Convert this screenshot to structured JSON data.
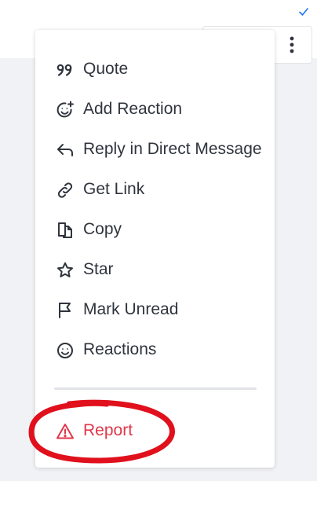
{
  "menu": {
    "items": [
      {
        "label": "Quote",
        "icon": "quote-icon"
      },
      {
        "label": "Add Reaction",
        "icon": "add-reaction-icon"
      },
      {
        "label": "Reply in Direct Message",
        "icon": "reply-arrow-icon"
      },
      {
        "label": "Get Link",
        "icon": "link-icon"
      },
      {
        "label": "Copy",
        "icon": "copy-icon"
      },
      {
        "label": "Star",
        "icon": "star-icon"
      },
      {
        "label": "Mark Unread",
        "icon": "flag-icon"
      },
      {
        "label": "Reactions",
        "icon": "smiley-icon"
      }
    ],
    "report": {
      "label": "Report",
      "icon": "warning-icon"
    }
  },
  "colors": {
    "text": "#2f343d",
    "danger": "#e0364a",
    "annotation": "#e0101c",
    "check": "#1d74f5"
  }
}
